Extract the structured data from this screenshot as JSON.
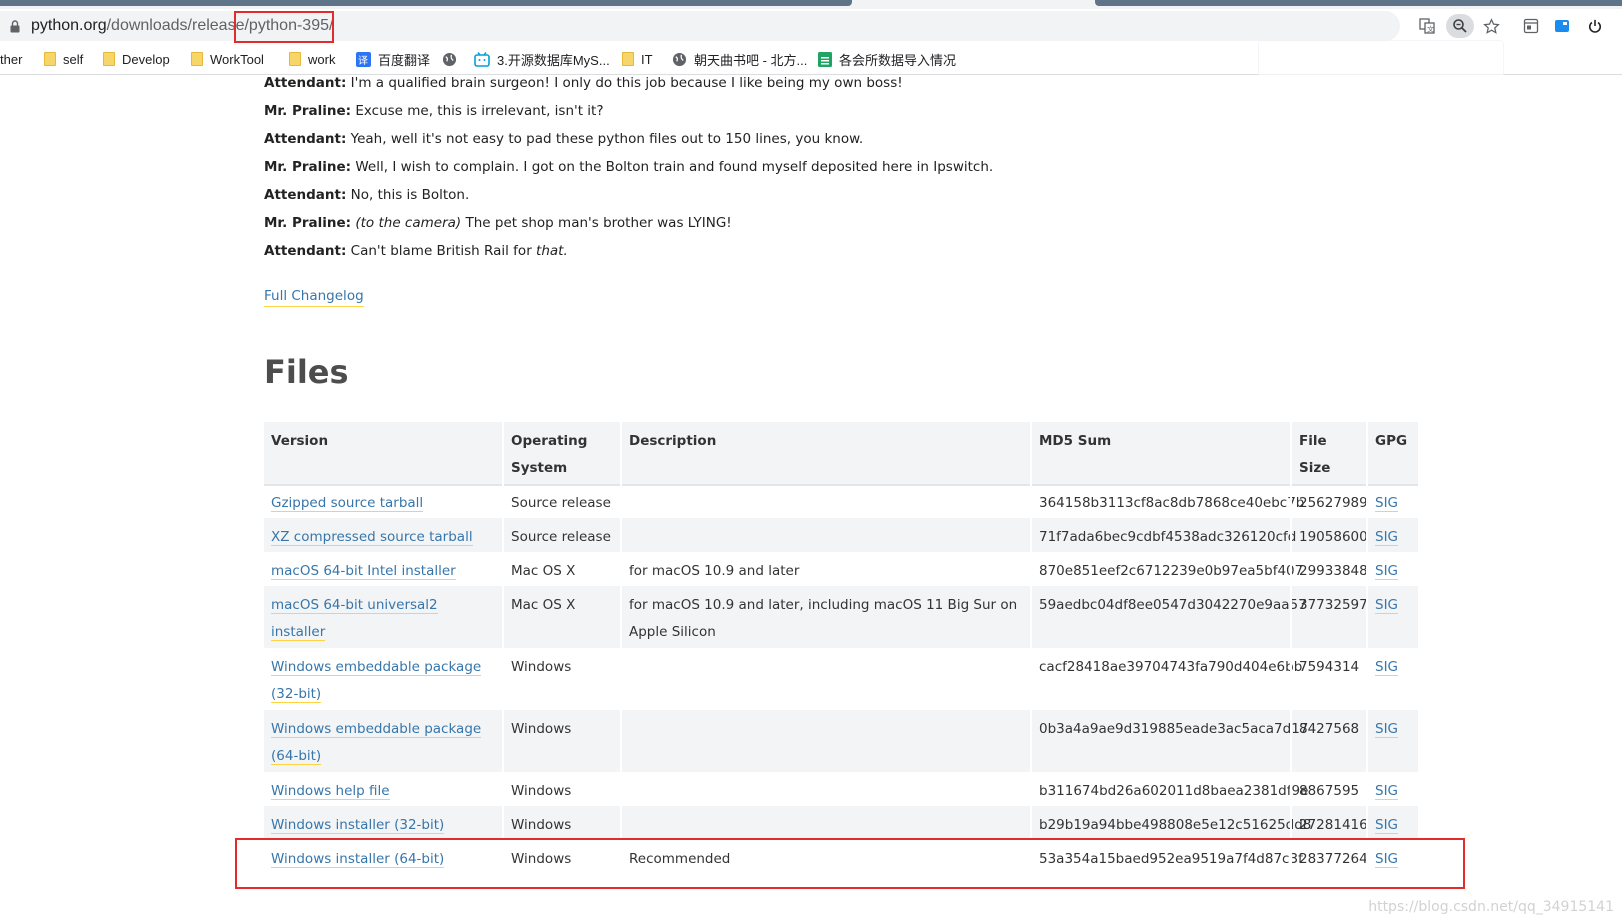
{
  "browser": {
    "url_host": "python.org",
    "url_path": "/downloads/release/python-395/",
    "bookmarks": [
      {
        "label": "ther",
        "icon": "none"
      },
      {
        "label": "self",
        "icon": "folder-icon"
      },
      {
        "label": "Develop",
        "icon": "folder-icon"
      },
      {
        "label": "WorkTool",
        "icon": "folder-icon"
      },
      {
        "label": "work",
        "icon": "folder-icon"
      },
      {
        "label": "百度翻译",
        "icon": "translate-icon"
      },
      {
        "label": "",
        "icon": "globe-icon"
      },
      {
        "label": "3.开源数据库MyS...",
        "icon": "bilibili-icon"
      },
      {
        "label": "IT",
        "icon": "folder-icon"
      },
      {
        "label": "朝天曲书吧 - 北方...",
        "icon": "globe-icon"
      },
      {
        "label": "各会所数据导入情况",
        "icon": "sheet-icon"
      }
    ],
    "colors": {
      "highlight": "#e02c2c",
      "link": "#3776ab",
      "link_underline": "#ffd343"
    }
  },
  "dialog": [
    {
      "speaker": "Attendant:",
      "pre": "",
      "italic": "",
      "text": " I'm a qualified brain surgeon! I only do this job because I like being my own boss!",
      "end_italic": ""
    },
    {
      "speaker": "Mr. Praline:",
      "pre": "",
      "italic": "",
      "text": " Excuse me, this is irrelevant, isn't it?",
      "end_italic": ""
    },
    {
      "speaker": "Attendant:",
      "pre": "",
      "italic": "",
      "text": " Yeah, well it's not easy to pad these python files out to 150 lines, you know.",
      "end_italic": ""
    },
    {
      "speaker": "Mr. Praline:",
      "pre": "",
      "italic": "",
      "text": " Well, I wish to complain. I got on the Bolton train and found myself deposited here in Ipswitch.",
      "end_italic": ""
    },
    {
      "speaker": "Attendant:",
      "pre": "",
      "italic": "",
      "text": " No, this is Bolton.",
      "end_italic": ""
    },
    {
      "speaker": "Mr. Praline:",
      "pre": " ",
      "italic": "(to the camera)",
      "text": " The pet shop man's brother was LYING!",
      "end_italic": ""
    },
    {
      "speaker": "Attendant:",
      "pre": "",
      "italic": "",
      "text": " Can't blame British Rail for ",
      "end_italic": "that."
    }
  ],
  "changelog_link": "Full Changelog",
  "files": {
    "title": "Files",
    "headers": [
      "Version",
      "Operating System",
      "Description",
      "MD5 Sum",
      "File Size",
      "GPG"
    ],
    "rows": [
      {
        "version": "Gzipped source tarball",
        "os": "Source release",
        "desc": "",
        "md5": "364158b3113cf8ac8db7868ce40ebc7b",
        "size": "25627989",
        "gpg": "SIG"
      },
      {
        "version": "XZ compressed source tarball",
        "os": "Source release",
        "desc": "",
        "md5": "71f7ada6bec9cdbf4538adc326120cfd",
        "size": "19058600",
        "gpg": "SIG"
      },
      {
        "version": "macOS 64-bit Intel installer",
        "os": "Mac OS X",
        "desc": "for macOS 10.9 and later",
        "md5": "870e851eef2c6712239e0b97ea5bf407",
        "size": "29933848",
        "gpg": "SIG"
      },
      {
        "version": "macOS 64-bit universal2 installer",
        "os": "Mac OS X",
        "desc": "for macOS 10.9 and later, including macOS 11 Big Sur on Apple Silicon",
        "md5": "59aedbc04df8ee0547d3042270e9aa57",
        "size": "37732597",
        "gpg": "SIG"
      },
      {
        "version": "Windows embeddable package (32-bit)",
        "os": "Windows",
        "desc": "",
        "md5": "cacf28418ae39704743fa790d404e6bb",
        "size": "7594314",
        "gpg": "SIG"
      },
      {
        "version": "Windows embeddable package (64-bit)",
        "os": "Windows",
        "desc": "",
        "md5": "0b3a4a9ae9d319885eade3ac5aca7d17",
        "size": "8427568",
        "gpg": "SIG"
      },
      {
        "version": "Windows help file",
        "os": "Windows",
        "desc": "",
        "md5": "b311674bd26a602011d8baea2381df9e",
        "size": "8867595",
        "gpg": "SIG"
      },
      {
        "version": "Windows installer (32-bit)",
        "os": "Windows",
        "desc": "",
        "md5": "b29b19a94bbe498808e5e12c51625dd8",
        "size": "27281416",
        "gpg": "SIG"
      },
      {
        "version": "Windows installer (64-bit)",
        "os": "Windows",
        "desc": "Recommended",
        "md5": "53a354a15baed952ea9519a7f4d87c3f",
        "size": "28377264",
        "gpg": "SIG"
      }
    ]
  },
  "watermark": "https://blog.csdn.net/qq_34915141"
}
